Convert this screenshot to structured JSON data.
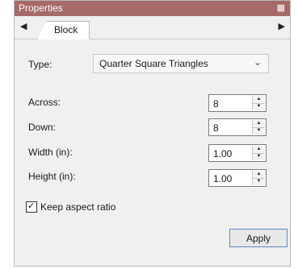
{
  "window": {
    "title": "Properties",
    "pin_icon": "pin-icon"
  },
  "tabs": {
    "left_arrow_icon": "arrow-left-icon",
    "right_arrow_icon": "arrow-right-icon",
    "active_tab": "Block"
  },
  "form": {
    "type_label": "Type:",
    "type_value": "Quarter Square Triangles",
    "across_label": "Across:",
    "across_value": "8",
    "down_label": "Down:",
    "down_value": "8",
    "width_label": "Width (in):",
    "width_value": "1.00",
    "height_label": "Height (in):",
    "height_value": "1.00",
    "keep_aspect_label": "Keep aspect ratio",
    "keep_aspect_checked": true
  },
  "actions": {
    "apply_label": "Apply"
  },
  "colors": {
    "titlebar": "#a56a68",
    "panel": "#f0f0f0",
    "button_border": "#5f86c6"
  }
}
